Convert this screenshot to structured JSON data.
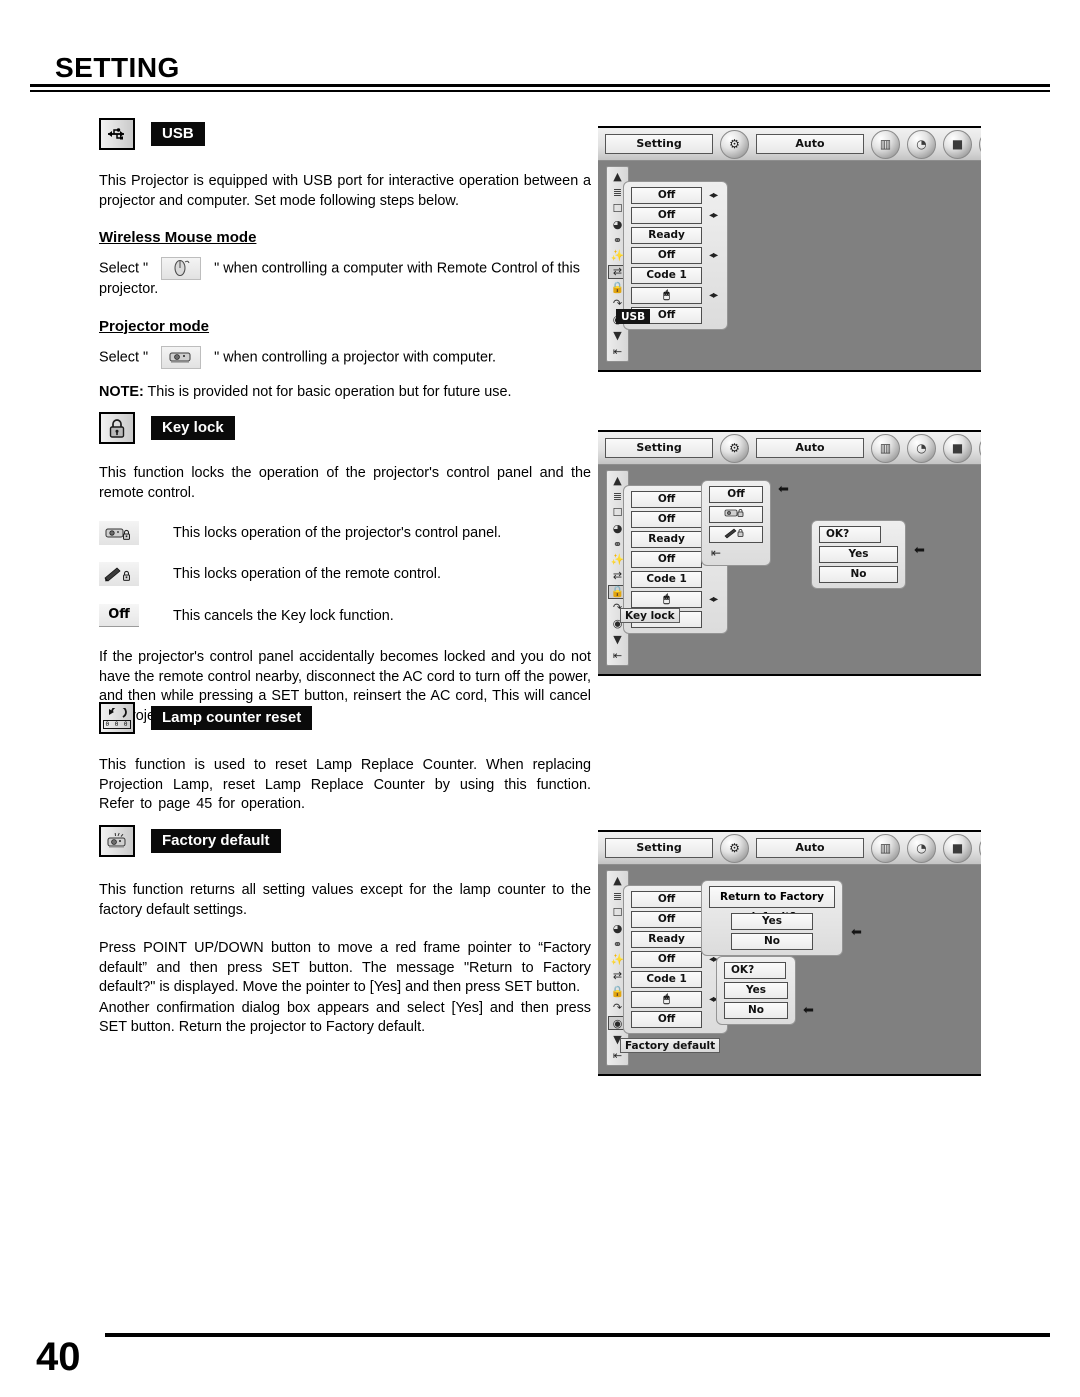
{
  "header": {
    "title": "SETTING"
  },
  "footer": {
    "page_number": "40"
  },
  "sections": {
    "usb": {
      "icon_name": "usb-icon",
      "label": "USB",
      "intro": "This Projector is equipped with USB port for interactive operation between a projector and computer. Set mode following steps below.",
      "wireless": {
        "heading": "Wireless Mouse mode",
        "text_before": "Select \"",
        "text_after": "\" when controlling a computer with Remote Control of this projector."
      },
      "projector": {
        "heading": "Projector mode",
        "text_before": "Select \"",
        "text_after": "\" when controlling a projector with computer."
      },
      "note_label": "NOTE:",
      "note_text": " This is provided not for basic operation but for future use."
    },
    "keylock": {
      "icon_name": "padlock-icon",
      "label": "Key lock",
      "intro": "This function locks the operation of the projector's control panel and the remote control.",
      "items": [
        {
          "icon_name": "projector-lock-icon",
          "text": "This locks operation of the projector's control panel."
        },
        {
          "icon_name": "remote-lock-icon",
          "text": "This locks operation of the remote control."
        },
        {
          "icon_name": "off-chip",
          "chip_text": "Off",
          "text": "This cancels the Key lock function."
        }
      ],
      "outro": "If the projector's control panel accidentally becomes locked and you do not have the remote control nearby, disconnect the AC cord to turn off the power, and then while pressing a SET button, reinsert the AC cord, This will cancel the projector's control panel lock."
    },
    "lamp": {
      "icon_name": "lamp-counter-reset-icon",
      "icon_digits": "0 0 0",
      "label": "Lamp counter reset",
      "text": "This function is used to reset Lamp Replace Counter.  When replacing Projection Lamp, reset Lamp Replace Counter by using this function.  Refer to page 45 for operation."
    },
    "factory": {
      "icon_name": "factory-default-icon",
      "label": "Factory default",
      "text1": "This function returns all setting values except for the lamp counter to the factory default settings.",
      "text2": "Press POINT UP/DOWN button to move a red frame pointer to “Factory default” and then press SET button.  The message \"Return to Factory default?\" is displayed.  Move the pointer to [Yes] and then press SET button.",
      "text3": "Another confirmation dialog box appears and select [Yes] and then press SET button. Return the projector to Factory default."
    }
  },
  "osd": {
    "menubar": {
      "current_menu": "Setting",
      "auto_button": "Auto",
      "gear_icon": "setting-gear-icon",
      "orbs": [
        {
          "name": "image-select-orb",
          "glyph": "▥"
        },
        {
          "name": "pc-adjust-orb",
          "glyph": "◔"
        },
        {
          "name": "screen-orb",
          "glyph": "■"
        },
        {
          "name": "sound-orb",
          "glyph": "◑"
        },
        {
          "name": "input-orb",
          "glyph": "◉"
        }
      ]
    },
    "rail_icons": [
      {
        "name": "scroll-up-icon",
        "glyph": "▲"
      },
      {
        "name": "language-icon",
        "glyph": "≡"
      },
      {
        "name": "blue-back-icon",
        "glyph": "⬜"
      },
      {
        "name": "display-icon",
        "glyph": "◕"
      },
      {
        "name": "lamp-mode-icon",
        "glyph": "⚲"
      },
      {
        "name": "remote-control-icon",
        "glyph": "╱"
      },
      {
        "name": "usb-icon",
        "glyph": "⇄"
      },
      {
        "name": "key-lock-icon",
        "glyph": "⚿"
      },
      {
        "name": "lamp-counter-reset-icon",
        "glyph": "⤴"
      },
      {
        "name": "factory-default-icon",
        "glyph": "☉"
      },
      {
        "name": "scroll-down-icon",
        "glyph": "▼"
      },
      {
        "name": "quit-icon",
        "glyph": "⇥"
      }
    ],
    "setting_values": [
      {
        "label": "Off",
        "has_arrows": true
      },
      {
        "label": "Off",
        "has_arrows": true
      },
      {
        "label": "Ready",
        "has_arrows": false
      },
      {
        "label": "Off",
        "has_arrows": true
      },
      {
        "label": "Code 1",
        "has_arrows": false
      },
      {
        "label": "",
        "icon": "mouse-icon",
        "has_arrows": true
      },
      {
        "label": "Off",
        "has_arrows": false
      }
    ],
    "shot_usb": {
      "highlight_tag": "USB",
      "highlight_row_value": "Off"
    },
    "shot_keylock": {
      "highlight_tag": "Key lock",
      "submenu": {
        "options": [
          {
            "label": "Off",
            "selected": true
          },
          {
            "icon": "projector-lock-icon",
            "selected": false
          },
          {
            "icon": "remote-lock-icon",
            "selected": false
          }
        ],
        "quit_icon": "quit-icon"
      },
      "confirm": {
        "title": "OK?",
        "yes": "Yes",
        "no": "No",
        "pointer_on": "Yes"
      }
    },
    "shot_factory": {
      "highlight_tag": "Factory default",
      "dialog1": {
        "message": "Return to Factory default?",
        "yes": "Yes",
        "no": "No",
        "pointer_on": "Yes"
      },
      "dialog2": {
        "title": "OK?",
        "yes": "Yes",
        "no": "No",
        "pointer_on": "No"
      }
    }
  }
}
